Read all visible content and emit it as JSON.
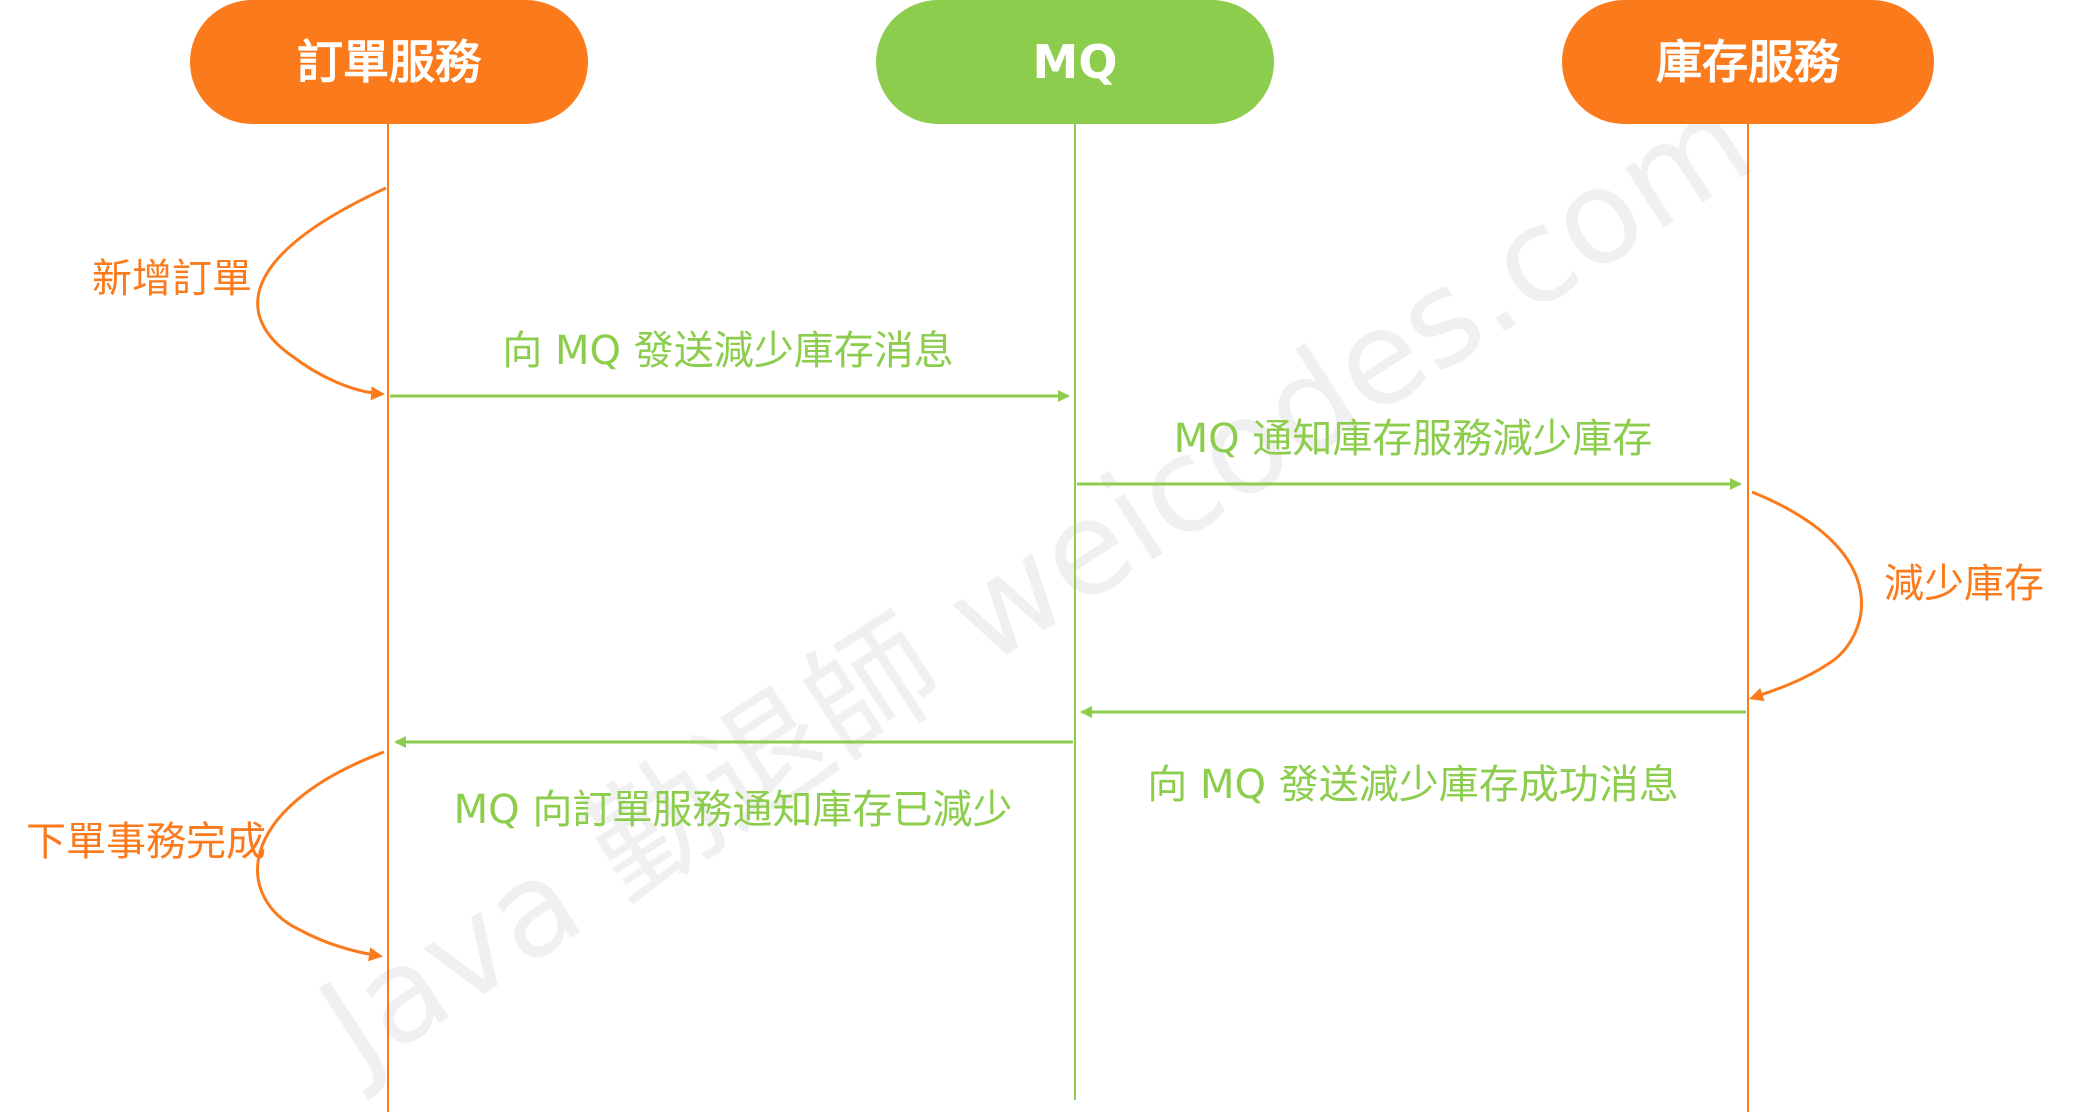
{
  "colors": {
    "orange": "#fa7a1c",
    "green": "#8ccd4e",
    "white": "#ffffff"
  },
  "actors": [
    {
      "id": "order",
      "label": "訂單服務",
      "color": "orange"
    },
    {
      "id": "mq",
      "label": "MQ",
      "color": "green"
    },
    {
      "id": "inventory",
      "label": "庫存服務",
      "color": "orange"
    }
  ],
  "messages": [
    {
      "from": "order",
      "to": "mq",
      "label": "向 MQ 發送減少庫存消息",
      "color": "green"
    },
    {
      "from": "mq",
      "to": "inventory",
      "label": "MQ 通知庫存服務減少庫存",
      "color": "green"
    },
    {
      "from": "inventory",
      "to": "mq",
      "label": "向 MQ 發送減少庫存成功消息",
      "color": "green"
    },
    {
      "from": "mq",
      "to": "order",
      "label": "MQ 向訂單服務通知庫存已減少",
      "color": "green"
    }
  ],
  "self_steps": [
    {
      "actor": "order",
      "label": "新增訂單",
      "color": "orange"
    },
    {
      "actor": "inventory",
      "label": "減少庫存",
      "color": "orange"
    },
    {
      "actor": "order",
      "label": "下單事務完成",
      "color": "orange"
    }
  ],
  "watermark": "Java 勤退師 weicodes.com"
}
